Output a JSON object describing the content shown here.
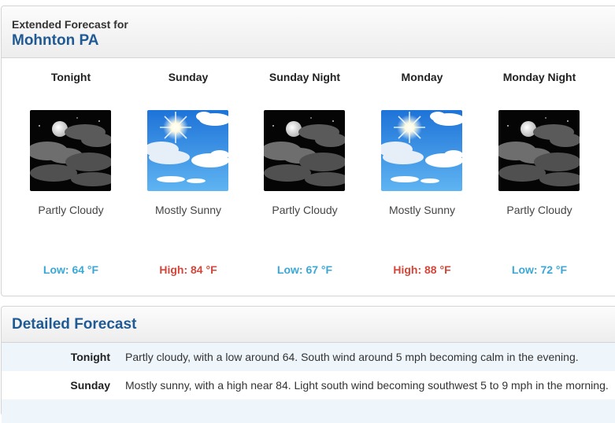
{
  "header": {
    "subtitle": "Extended Forecast for",
    "location": "Mohnton PA"
  },
  "periods": [
    {
      "name": "Tonight",
      "short": "Partly Cloudy",
      "temp": "Low: 64 °F",
      "icon": "partly-cloudy-night-icon"
    },
    {
      "name": "Sunday",
      "short": "Mostly Sunny",
      "temp": "High: 84 °F",
      "icon": "mostly-sunny-icon"
    },
    {
      "name": "Sunday Night",
      "short": "Partly Cloudy",
      "temp": "Low: 67 °F",
      "icon": "partly-cloudy-night-icon"
    },
    {
      "name": "Monday",
      "short": "Mostly Sunny",
      "temp": "High: 88 °F",
      "icon": "mostly-sunny-icon"
    },
    {
      "name": "Monday Night",
      "short": "Partly Cloudy",
      "temp": "Low: 72 °F",
      "icon": "partly-cloudy-night-icon"
    }
  ],
  "detailed": {
    "title": "Detailed Forecast",
    "rows": [
      {
        "label": "Tonight",
        "text": "Partly cloudy, with a low around 64. South wind around 5 mph becoming calm in the evening."
      },
      {
        "label": "Sunday",
        "text": "Mostly sunny, with a high near 84. Light south wind becoming southwest 5 to 9 mph in the morning."
      }
    ]
  },
  "colors": {
    "title_blue": "#1f5a94",
    "low_temp": "#3aa7d6",
    "high_temp": "#d2473a",
    "row_stripe": "#eef5fb"
  }
}
